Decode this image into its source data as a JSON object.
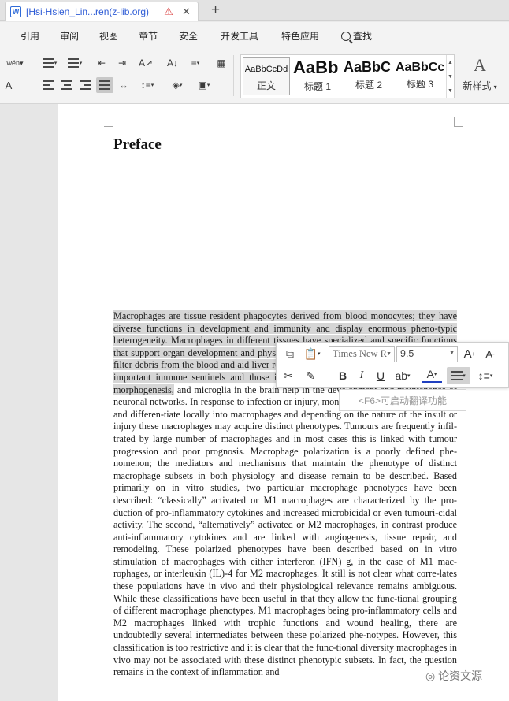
{
  "titlebar": {
    "tab_title": "[Hsi-Hsien_Lin...ren(z-lib.org)",
    "doc_icon": "W"
  },
  "menu": {
    "items": [
      "引用",
      "审阅",
      "视图",
      "章节",
      "安全",
      "开发工具",
      "特色应用"
    ],
    "search_label": "查找"
  },
  "ribbon": {
    "phonetic_label": "wén",
    "styles": [
      {
        "sample": "AaBbCcDd",
        "label": "正文"
      },
      {
        "sample": "AaBb",
        "label": "标题 1"
      },
      {
        "sample": "AaBbC",
        "label": "标题 2"
      },
      {
        "sample": "AaBbCc",
        "label": "标题 3"
      }
    ],
    "new_style_glyph": "A",
    "new_style_label": "新样式"
  },
  "document": {
    "heading": "Preface",
    "selected_text": "Macrophages are tissue resident phagocytes derived from blood monocytes; they have diverse functions in development and immunity and display enormous pheno-typic heterogeneity. Macrophages in different tissues have specialized and specific functions that support organ development and physiology. For example, macrophages in the liver filter debris from the blood and aid liver regeneration, while macrophages in the skin are important immune sentinels and those in the bone, called osteoclasts mediate bone morphogenesis,",
    "rest_text": " and microglia in the brain help in the development and maintenance of neuronal networks. In response to infection or injury, monocytes are recruited into tissue and differen-tiate locally into macrophages and depending on the nature of the insult or injury these macrophages may acquire distinct phenotypes. Tumours are frequently infil-trated by large number of macrophages and in most cases this is linked with tumour progression and poor prognosis. Macrophage polarization is a poorly defined phe-nomenon; the mediators and mechanisms that maintain the phenotype of distinct macrophage subsets in both physiology and disease remain to be described. Based primarily on in vitro studies, two particular macrophage phenotypes have been described: “classically” activated or M1 macrophages are characterized by the pro-duction of pro-inflammatory cytokines and increased microbicidal or even tumouri-cidal activity. The second, “alternatively” activated or M2 macrophages, in contrast produce anti-inflammatory cytokines and are linked with angiogenesis, tissue repair, and remodeling. These polarized phenotypes have been described based on in vitro stimulation of macrophages with either interferon (IFN) g, in the case of M1 mac-rophages, or interleukin (IL)-4 for M2 macrophages. It still is not clear what corre-lates these populations have in vivo and their physiological relevance remains ambiguous. While these classifications have been useful in that they allow the func-tional grouping of different macrophage phenotypes, M1 macrophages being pro-inflammatory cells and M2 macrophages linked with trophic functions and wound healing, there are undoubtedly several intermediates between these polarized phe-notypes. However, this classification is too restrictive and it is clear that the func-tional diversity macrophages in vivo may not be associated with these distinct phenotypic subsets. In fact, the question remains in the context of inflammation and"
  },
  "minibar": {
    "font_name": "Times New R",
    "font_size": "9.5",
    "bold": "B",
    "italic": "I",
    "underline": "U",
    "tooltip": "<F6>可启动翻译功能"
  },
  "watermark": "论资文源"
}
